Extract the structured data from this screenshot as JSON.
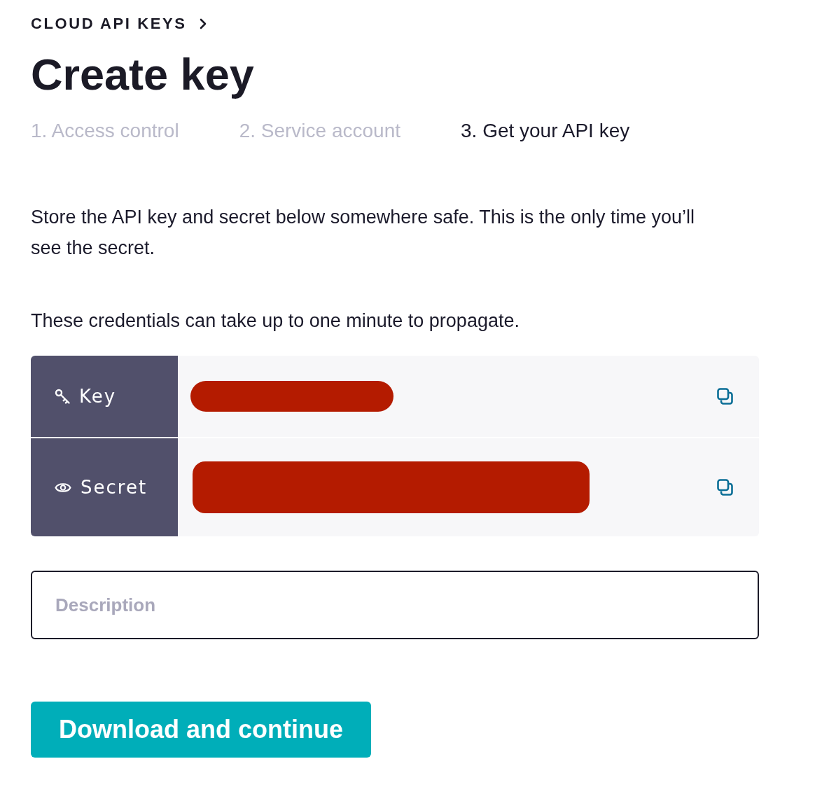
{
  "breadcrumb": {
    "label": "CLOUD API KEYS"
  },
  "page_title": "Create key",
  "steps": [
    {
      "label": "1. Access control",
      "selected": false
    },
    {
      "label": "2. Service account",
      "selected": false
    },
    {
      "label": "3. Get your API key",
      "selected": true
    }
  ],
  "instructions": [
    "Store the API key and secret below somewhere safe. This is the only time you’ll see the secret.",
    "These credentials can take up to one minute to propagate."
  ],
  "credentials": [
    {
      "kind": "key",
      "label": "Key",
      "redacted": true
    },
    {
      "kind": "secret",
      "label": "Secret",
      "redacted": true
    }
  ],
  "description_field": {
    "placeholder": "Description"
  },
  "primary_button": {
    "label": "Download and continue"
  }
}
